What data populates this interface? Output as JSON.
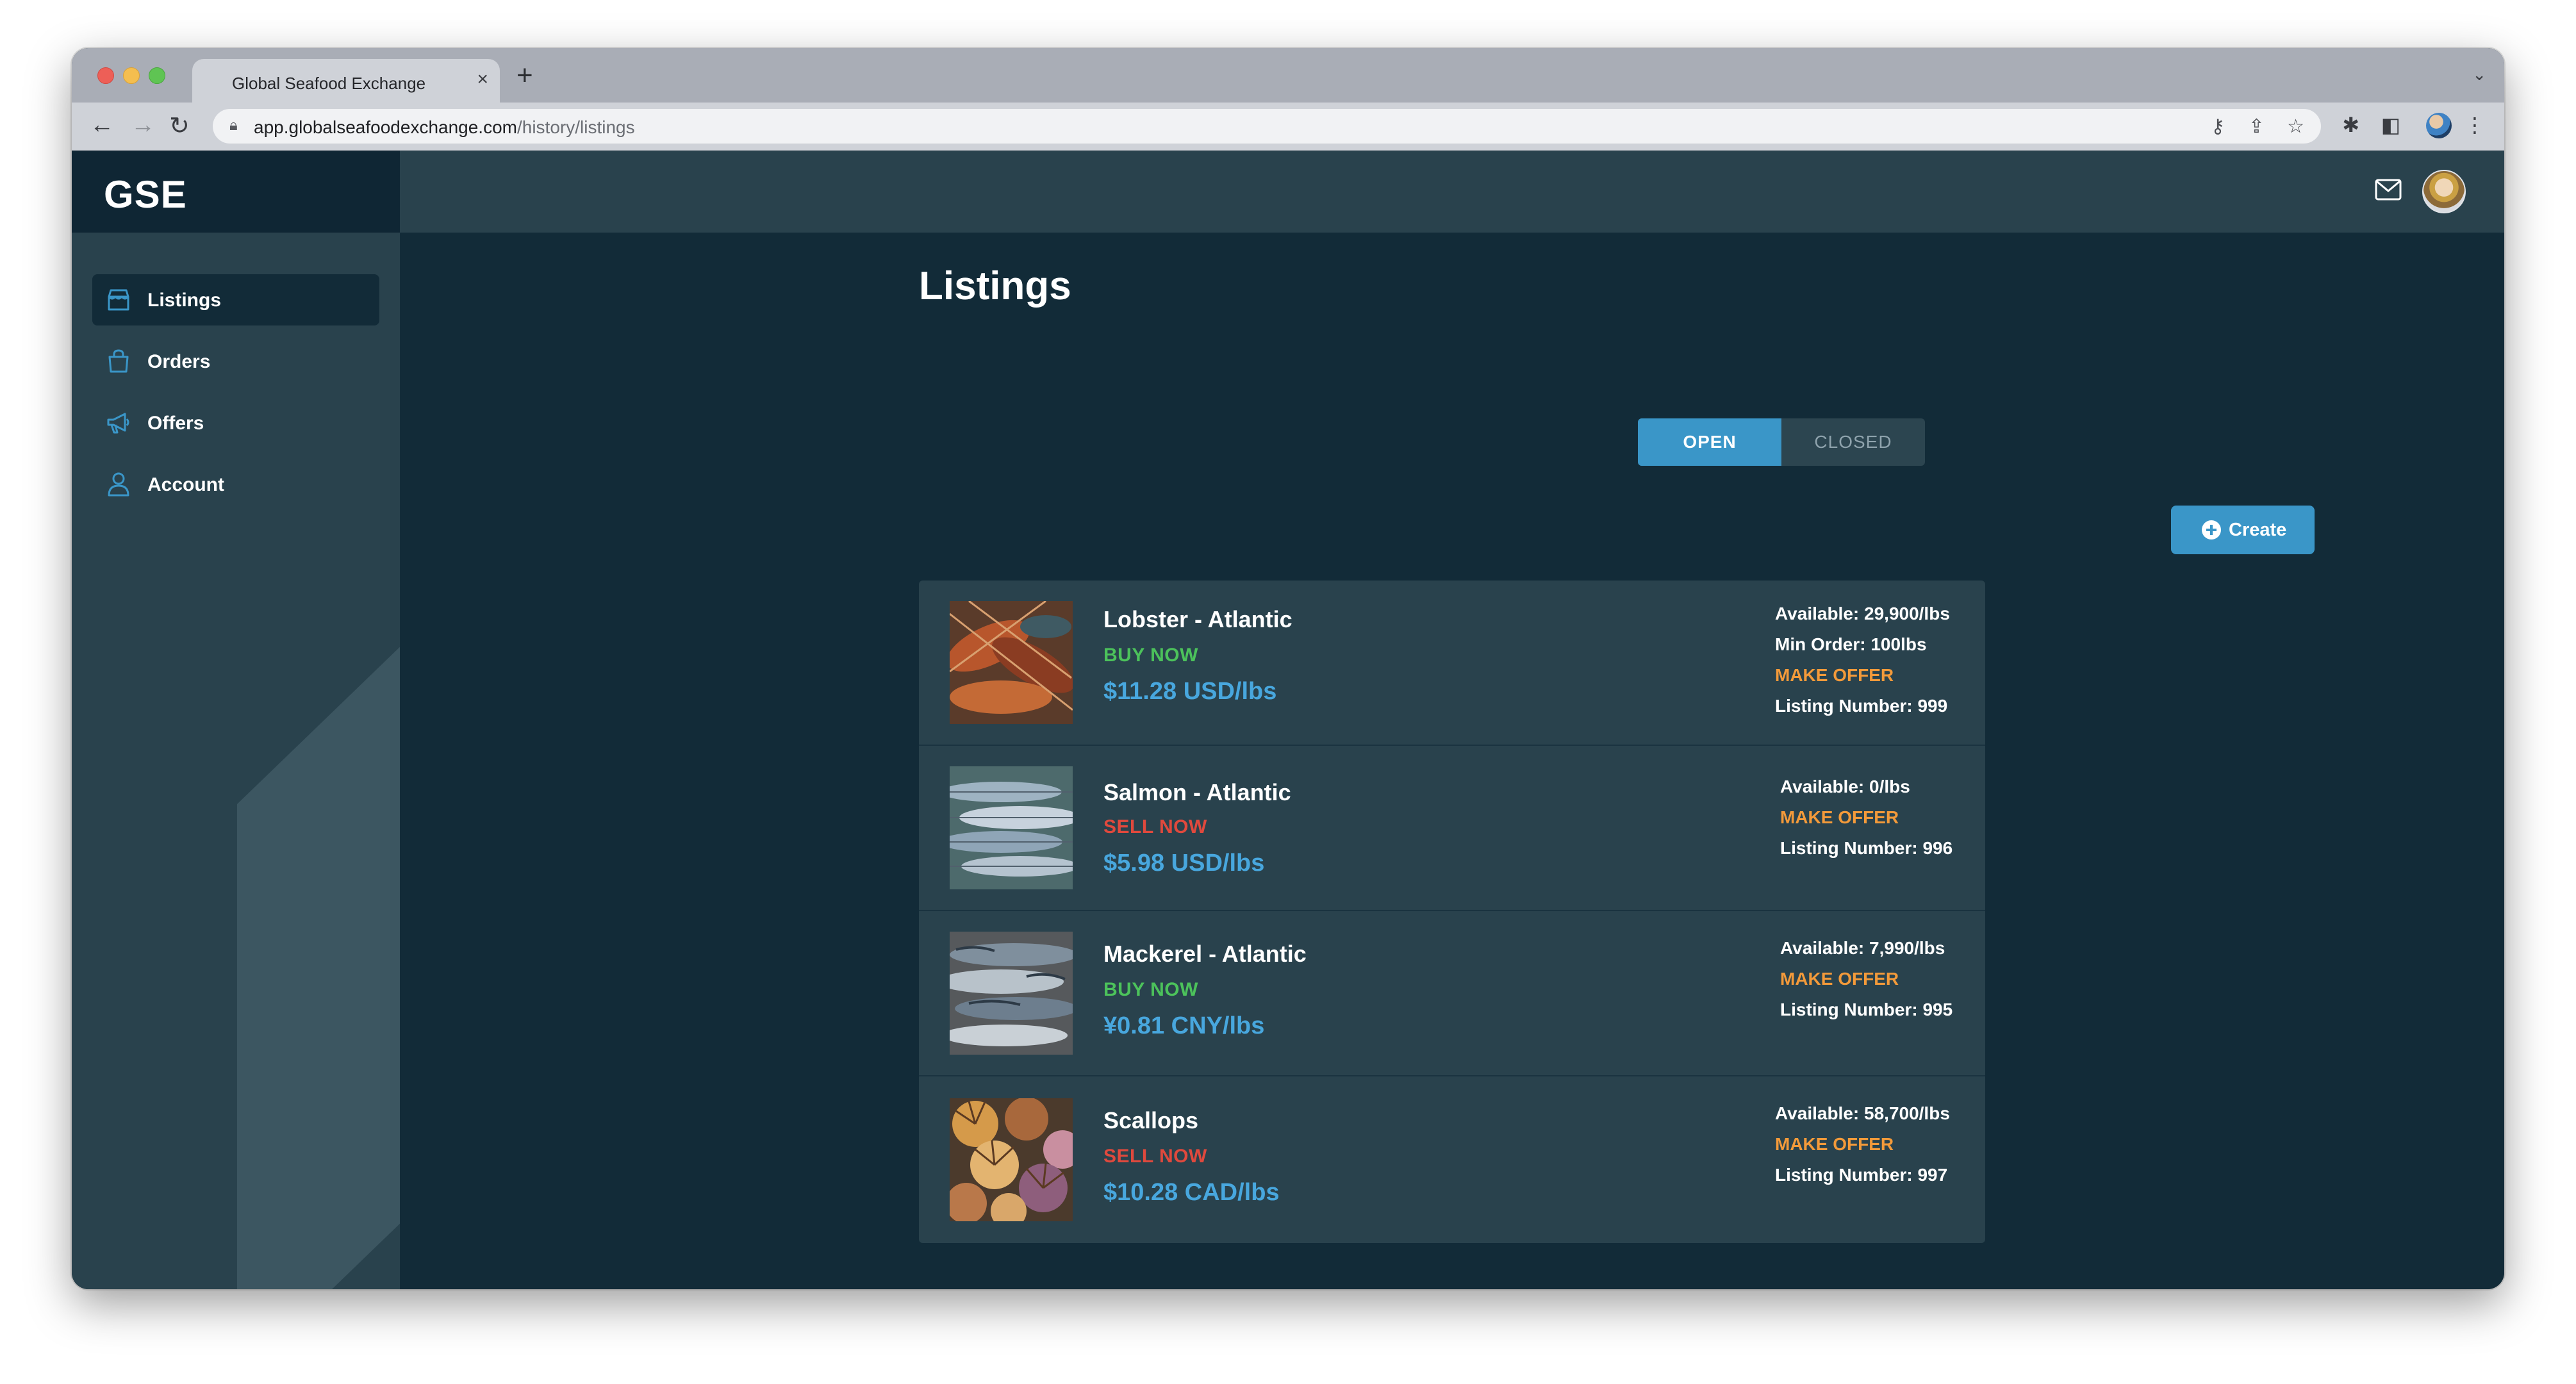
{
  "browser": {
    "tab_title": "Global Seafood Exchange",
    "tab_close": "×",
    "new_tab": "+",
    "url_host": "app.globalseafoodexchange.com",
    "url_path": "/history/listings"
  },
  "brand": "GSE",
  "sidebar": {
    "items": [
      {
        "label": "Listings",
        "icon": "store-icon",
        "active": true
      },
      {
        "label": "Orders",
        "icon": "shopping-bag-icon",
        "active": false
      },
      {
        "label": "Offers",
        "icon": "megaphone-icon",
        "active": false
      },
      {
        "label": "Account",
        "icon": "user-icon",
        "active": false
      }
    ]
  },
  "page": {
    "title": "Listings",
    "tabs": [
      {
        "label": "OPEN",
        "selected": true
      },
      {
        "label": "CLOSED",
        "selected": false
      }
    ],
    "create_label": "Create"
  },
  "listings": [
    {
      "name": "Lobster - Atlantic",
      "action": "BUY NOW",
      "action_type": "buy",
      "price": "$11.28 USD/lbs",
      "available": "Available: 29,900/lbs",
      "min_order": "Min Order: 100lbs",
      "offer": "MAKE OFFER",
      "listing_number": "Listing Number: 999"
    },
    {
      "name": "Salmon - Atlantic",
      "action": "SELL NOW",
      "action_type": "sell",
      "price": "$5.98 USD/lbs",
      "available": "Available: 0/lbs",
      "offer": "MAKE OFFER",
      "listing_number": "Listing Number: 996"
    },
    {
      "name": "Mackerel - Atlantic",
      "action": "BUY NOW",
      "action_type": "buy",
      "price": "¥0.81 CNY/lbs",
      "available": "Available: 7,990/lbs",
      "offer": "MAKE OFFER",
      "listing_number": "Listing Number: 995"
    },
    {
      "name": "Scallops",
      "action": "SELL NOW",
      "action_type": "sell",
      "price": "$10.28 CAD/lbs",
      "available": "Available: 58,700/lbs",
      "offer": "MAKE OFFER",
      "listing_number": "Listing Number: 997"
    }
  ],
  "colors": {
    "background": "#122b38",
    "panel": "#29424d",
    "accent": "#3a96c8",
    "buy": "#4cc25b",
    "sell": "#e0493d",
    "offer": "#f39a3a",
    "price": "#48a7de"
  }
}
